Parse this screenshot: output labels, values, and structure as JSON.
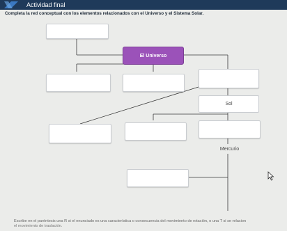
{
  "header": {
    "title": "Actividad final"
  },
  "instruction": "Completa la red conceptual con los elementos relacionados con el Universo y el Sistema Solar.",
  "nodes": {
    "center": "El Universo",
    "sun": "Sol",
    "mercury": "Mercurio"
  },
  "footer": {
    "line1": "Escribe en el paréntesis una R si el enunciado es una característica o consecuencia del movimiento de rotación, o una T si se relacion",
    "line2": "el movimiento de traslación."
  },
  "colors": {
    "header": "#1f3a5a",
    "center_node": "#9b52b9",
    "background": "#ebecea"
  }
}
